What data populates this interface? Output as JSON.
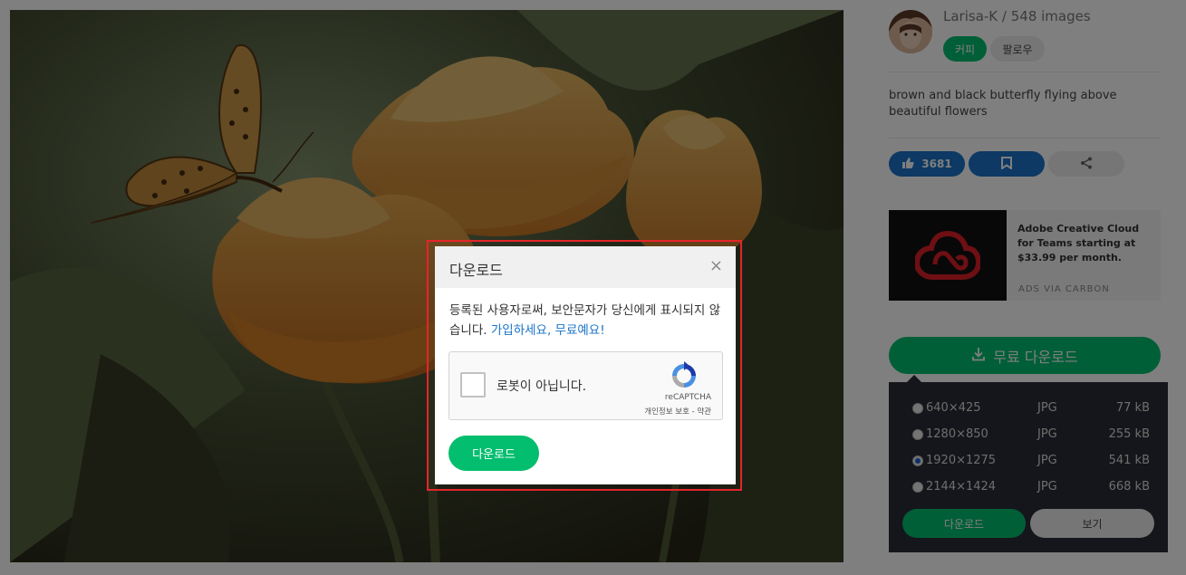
{
  "sidebar": {
    "author": "Larisa-K / 548 images",
    "coffee_label": "커피",
    "follow_label": "팔로우",
    "description": "brown and black butterfly flying above beautiful flowers",
    "like_count": "3681",
    "ad": {
      "text": "Adobe Creative Cloud for Teams starting at $33.99 per month.",
      "via": "ADS VIA CARBON"
    },
    "free_download_label": "무료 다운로드",
    "download_options": [
      {
        "resolution": "640×425",
        "format": "JPG",
        "size": "77 kB",
        "selected": false
      },
      {
        "resolution": "1280×850",
        "format": "JPG",
        "size": "255 kB",
        "selected": false
      },
      {
        "resolution": "1920×1275",
        "format": "JPG",
        "size": "541 kB",
        "selected": true
      },
      {
        "resolution": "2144×1424",
        "format": "JPG",
        "size": "668 kB",
        "selected": false
      }
    ],
    "panel_download_label": "다운로드",
    "panel_view_label": "보기"
  },
  "modal": {
    "title": "다운로드",
    "close": "×",
    "message": "등록된 사용자로써, 보안문자가 당신에게 표시되지 않습니다.",
    "link_text": "가입하세요, 무료예요!",
    "captcha": {
      "label": "로봇이 아닙니다.",
      "brand": "reCAPTCHA",
      "terms": "개인정보 보호 - 약관"
    },
    "download_label": "다운로드"
  },
  "colors": {
    "primary_green": "#02be6e",
    "primary_blue": "#1a73c8",
    "highlight_red": "#e5252a",
    "panel_dark": "#2a2c36"
  }
}
